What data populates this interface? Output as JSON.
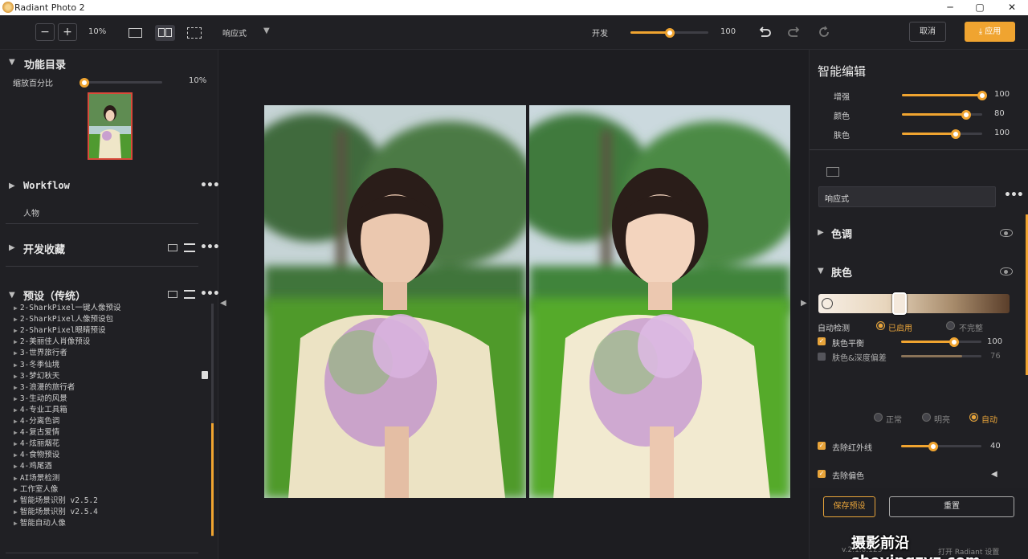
{
  "window": {
    "title": "Radiant Photo 2",
    "controls": {
      "minimize": "─",
      "maximize": "▢",
      "close": "✕"
    }
  },
  "toolbar": {
    "zoom_out": "−",
    "zoom_in": "+",
    "zoom_level": "10%",
    "view_mode": "响应式",
    "dropdown_arrow": "▼",
    "strength_label": "开发",
    "strength_value": 100,
    "strength_value_text": "100",
    "cancel": "取消",
    "apply": "应用",
    "apply_icon": "⤓"
  },
  "left": {
    "catalog": {
      "title": "功能目录",
      "scale_label": "缩放百分比",
      "scale_value": 10,
      "scale_value_text": "10%"
    },
    "workflow": {
      "title": "Workflow",
      "item": "人物",
      "more": "•••"
    },
    "favorites": {
      "title": "开发收藏",
      "more": "•••"
    },
    "presets": {
      "title": "预设（传统）",
      "more": "•••",
      "items": [
        "2-SharkPixel一键人像预设",
        "2-SharkPixel人像预设包",
        "2-SharkPixel眼睛预设",
        "2-美丽佳人肖像预设",
        "3-世界旅行者",
        "3-冬季仙境",
        "3-梦幻秋天",
        "3-浪漫的旅行者",
        "3-生动的风景",
        "4-专业工具箱",
        "4-分离色调",
        "4-复古爱情",
        "4-炫丽烟花",
        "4-食物预设",
        "4-鸡尾酒",
        "AI场景检测",
        "工作室人像",
        "智能场景识别 v2.5.2",
        "智能场景识别 v2.5.4",
        "智能自动人像"
      ]
    }
  },
  "right": {
    "title": "智能编辑",
    "sliders": [
      {
        "label": "增强",
        "value": 100,
        "text": "100"
      },
      {
        "label": "颜色",
        "value": 80,
        "text": "80"
      },
      {
        "label": "肤色",
        "value": 100,
        "text": "100"
      }
    ],
    "preset_select": "响应式",
    "more": "•••",
    "tone_section": "色调",
    "skin_section": "肤色",
    "auto_detect": {
      "label": "自动检测",
      "on": "已启用",
      "off": "不完整"
    },
    "skin_balance": {
      "label": "肤色平衡",
      "value": 100,
      "text": "100"
    },
    "skin_depth": {
      "label": "肤色&深度偏差",
      "value": 76,
      "text": "76"
    },
    "modes": {
      "normal": "正常",
      "bright": "明亮",
      "auto": "自动"
    },
    "remove_ir": {
      "label": "去除红外线",
      "value": 40,
      "text": "40"
    },
    "remove_cast": {
      "label": "去除偏色"
    },
    "save_preset": "保存预设",
    "reset": "重置",
    "version": "v.2.1.0.123",
    "open_label": "打开 Radiant 设置"
  },
  "watermark": "摄影前沿 sheyingzyz.com",
  "colors": {
    "accent": "#f0a430",
    "panel": "#202024",
    "canvas": "#1d1d21"
  }
}
